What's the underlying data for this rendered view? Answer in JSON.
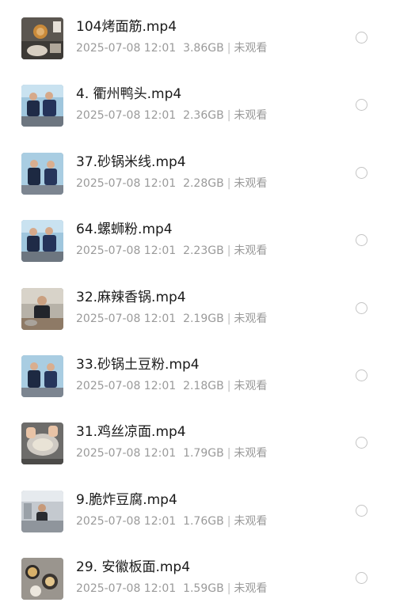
{
  "files": [
    {
      "name": "104烤面筋.mp4",
      "date": "2025-07-08 12:01",
      "size": "3.86GB",
      "status": "未观看",
      "icon": "video-thumbnail"
    },
    {
      "name": "4. 衢州鸭头.mp4",
      "date": "2025-07-08 12:01",
      "size": "2.36GB",
      "status": "未观看",
      "icon": "video-thumbnail"
    },
    {
      "name": "37.砂锅米线.mp4",
      "date": "2025-07-08 12:01",
      "size": "2.28GB",
      "status": "未观看",
      "icon": "video-thumbnail"
    },
    {
      "name": "64.螺蛳粉.mp4",
      "date": "2025-07-08 12:01",
      "size": "2.23GB",
      "status": "未观看",
      "icon": "video-thumbnail"
    },
    {
      "name": "32.麻辣香锅.mp4",
      "date": "2025-07-08 12:01",
      "size": "2.19GB",
      "status": "未观看",
      "icon": "video-thumbnail"
    },
    {
      "name": "33.砂锅土豆粉.mp4",
      "date": "2025-07-08 12:01",
      "size": "2.18GB",
      "status": "未观看",
      "icon": "video-thumbnail"
    },
    {
      "name": "31.鸡丝凉面.mp4",
      "date": "2025-07-08 12:01",
      "size": "1.79GB",
      "status": "未观看",
      "icon": "video-thumbnail"
    },
    {
      "name": "9.脆炸豆腐.mp4",
      "date": "2025-07-08 12:01",
      "size": "1.76GB",
      "status": "未观看",
      "icon": "video-thumbnail"
    },
    {
      "name": "29. 安徽板面.mp4",
      "date": "2025-07-08 12:01",
      "size": "1.59GB",
      "status": "未观看",
      "icon": "video-thumbnail"
    }
  ],
  "colors": {
    "title": "#1a1a1a",
    "meta": "#9a9a9a",
    "radio_border": "#c4c4c4"
  }
}
